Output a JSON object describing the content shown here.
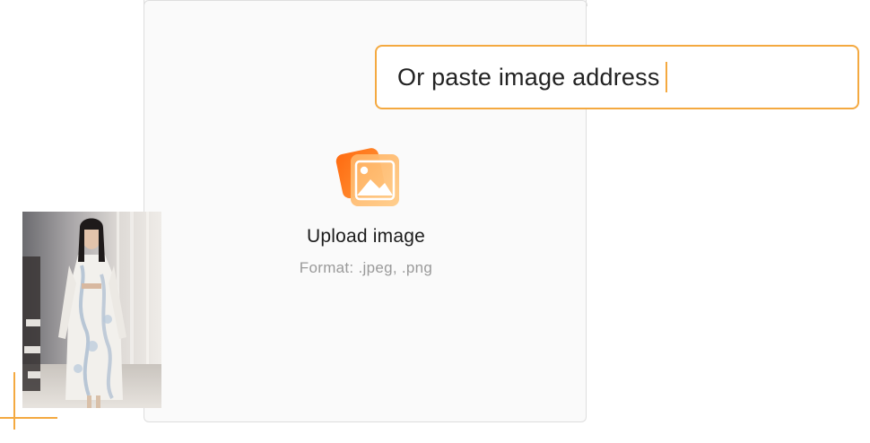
{
  "upload": {
    "title": "Upload image",
    "format": "Format: .jpeg, .png",
    "icon": "image-upload-icon"
  },
  "url_input": {
    "placeholder": "Or paste image address"
  },
  "photo": {
    "icon": "fashion-runway-photo"
  },
  "colors": {
    "accent": "#f4a940",
    "icon_gradient_start": "#ff7a1a",
    "icon_gradient_end": "#ffb347"
  }
}
